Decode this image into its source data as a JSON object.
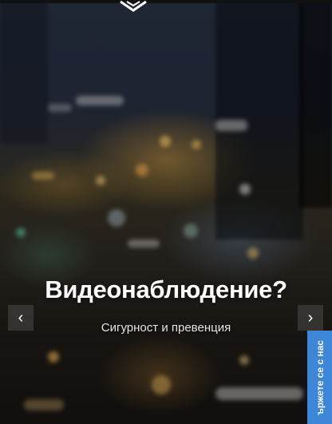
{
  "hero": {
    "title": "Видеонаблюдение?",
    "subtitle": "Сигурност и превенция"
  },
  "carousel": {
    "prev_icon": "chevron-left-icon",
    "next_icon": "chevron-right-icon",
    "prev_glyph": "‹",
    "next_glyph": "›"
  },
  "contact_tab": {
    "label": "ържете се с нас",
    "color": "#3d86d8"
  },
  "logo": {
    "icon": "shield-logo-icon"
  }
}
